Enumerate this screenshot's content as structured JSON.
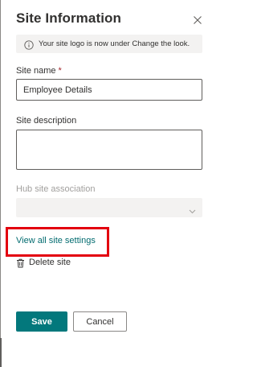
{
  "panel": {
    "title": "Site Information",
    "close_icon": "close-icon"
  },
  "notice": {
    "icon": "info-icon",
    "text": "Your site logo is now under Change the look."
  },
  "site_name": {
    "label": "Site name",
    "required_marker": "*",
    "value": "Employee Details"
  },
  "site_description": {
    "label": "Site description",
    "value": ""
  },
  "hub_site": {
    "label": "Hub site association",
    "selected": "",
    "disabled": true,
    "icon": "chevron-down-icon"
  },
  "links": {
    "view_all": "View all site settings",
    "delete": "Delete site",
    "delete_icon": "trash-icon"
  },
  "buttons": {
    "save": "Save",
    "cancel": "Cancel"
  },
  "colors": {
    "accent": "#03787c",
    "link": "#036c70",
    "highlight": "#e3000f",
    "required": "#a4262c"
  }
}
